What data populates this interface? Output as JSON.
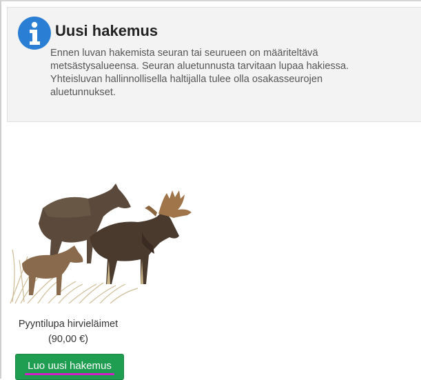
{
  "notice": {
    "icon": "info-icon",
    "icon_color": "#2a7fd4",
    "title": "Uusi hakemus",
    "lines": [
      "Ennen luvan hakemista seuran tai seurueen on määriteltävä",
      "metsästysalueensa. Seuran aluetunnusta tarvitaan lupaa hakiessa.",
      "Yhteisluvan hallinnollisella haltijalla tulee olla osakasseurojen",
      "aluetunnukset."
    ]
  },
  "product": {
    "image": "moose-illustration",
    "name": "Pyyntilupa hirvieläimet",
    "price": "(90,00 €)",
    "button_label": "Luo uusi hakemus",
    "button_color": "#1f9d50",
    "highlight_color": "#d21ec8"
  }
}
